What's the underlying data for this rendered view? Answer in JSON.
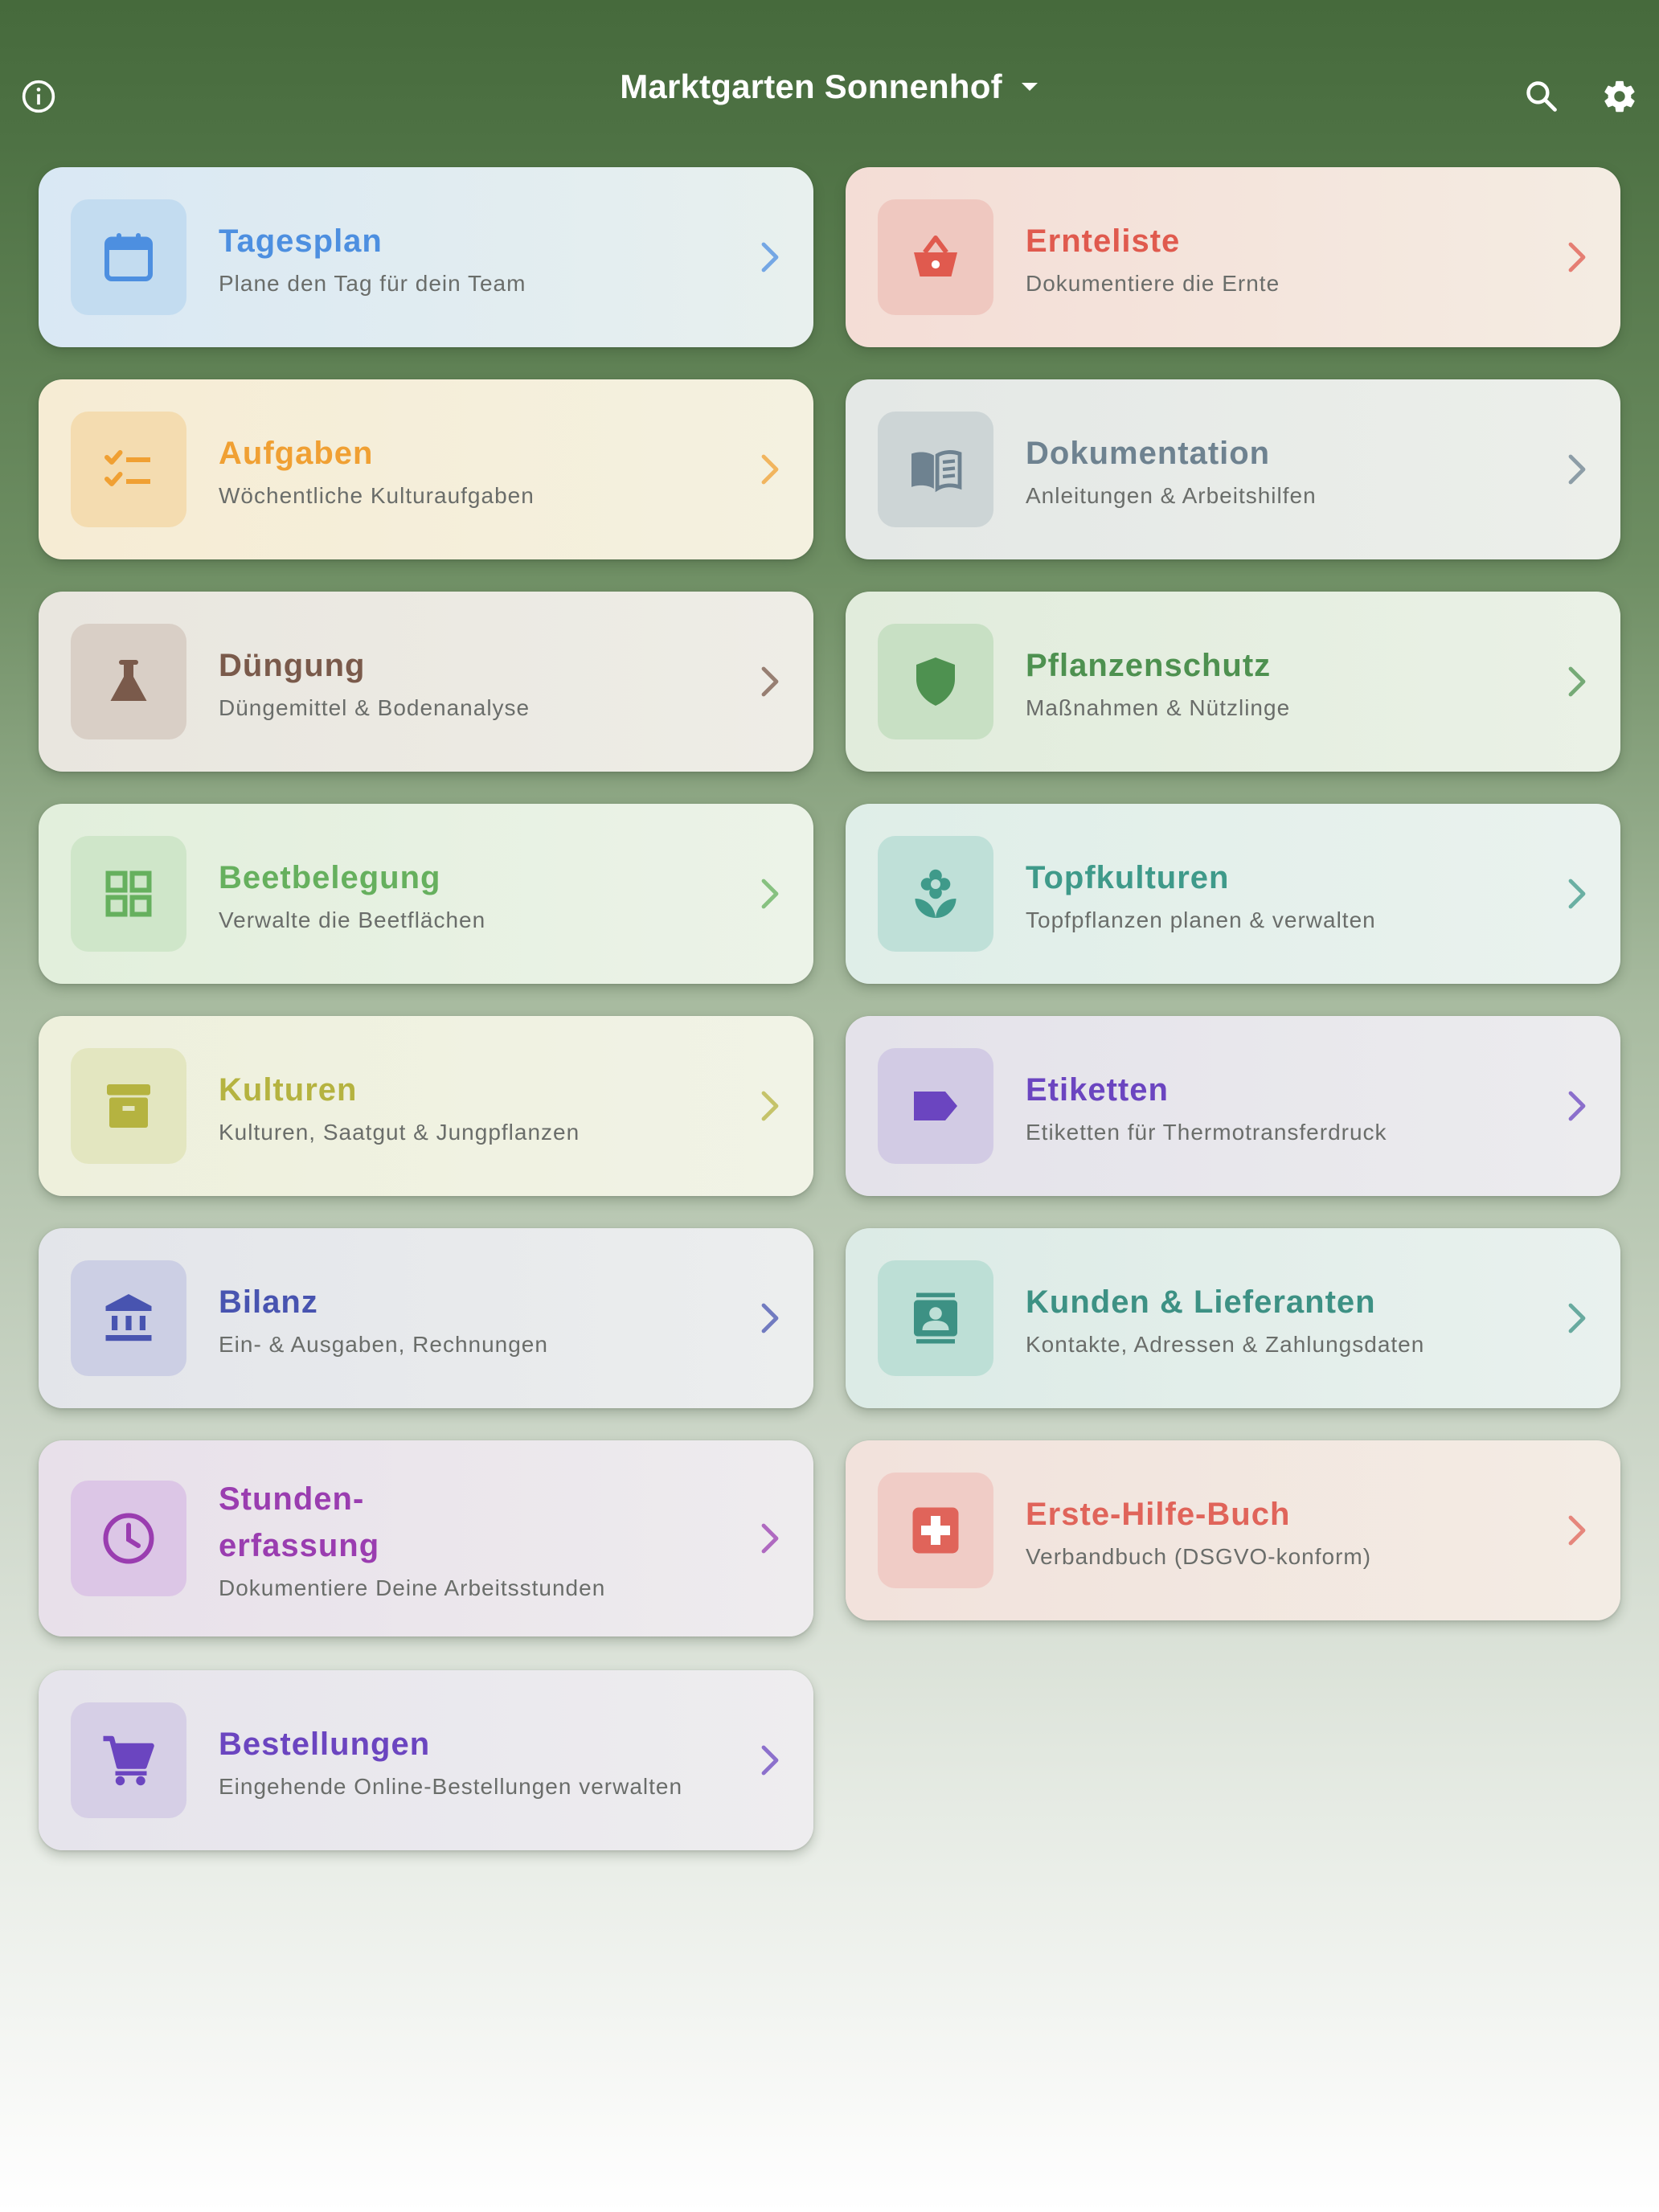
{
  "header": {
    "title": "Marktgarten Sonnenhof",
    "info_icon": "info-icon",
    "search_icon": "search-icon",
    "settings_icon": "gear-icon",
    "dropdown_icon": "caret-down-icon"
  },
  "cards": [
    {
      "id": "tagesplan",
      "title": "Tagesplan",
      "subtitle": "Plane den Tag für dein Team",
      "icon": "calendar-icon",
      "color": "#4d8fe0",
      "bg_from": "#d9e8f4",
      "bg_to": "#e8f0ee",
      "tile": "#c3dcf0"
    },
    {
      "id": "ernteliste",
      "title": "Ernteliste",
      "subtitle": "Dokumentiere die Ernte",
      "icon": "basket-icon",
      "color": "#e05a4e",
      "bg_from": "#f4ddd6",
      "bg_to": "#f4ece2",
      "tile": "#efc8c0"
    },
    {
      "id": "aufgaben",
      "title": "Aufgaben",
      "subtitle": "Wöchentliche Kulturaufgaben",
      "icon": "checklist-icon",
      "color": "#f0a033",
      "bg_from": "#f6ecd4",
      "bg_to": "#f4f1e0",
      "tile": "#f4dcb0"
    },
    {
      "id": "dokumentation",
      "title": "Dokumentation",
      "subtitle": "Anleitungen & Arbeitshilfen",
      "icon": "book-icon",
      "color": "#6e8290",
      "bg_from": "#e4e8e6",
      "bg_to": "#ecefea",
      "tile": "#cdd5d6"
    },
    {
      "id": "duengung",
      "title": "Düngung",
      "subtitle": "Düngemittel & Bodenanalyse",
      "icon": "flask-icon",
      "color": "#7a5a4b",
      "bg_from": "#e9e6df",
      "bg_to": "#eeede6",
      "tile": "#d9cfc6"
    },
    {
      "id": "pflanzenschutz",
      "title": "Pflanzenschutz",
      "subtitle": "Maßnahmen & Nützlinge",
      "icon": "shield-icon",
      "color": "#4e9150",
      "bg_from": "#e1ecdc",
      "bg_to": "#eaf1e6",
      "tile": "#c8e0c4"
    },
    {
      "id": "beetbelegung",
      "title": "Beetbelegung",
      "subtitle": "Verwalte die Beetflächen",
      "icon": "grid-icon",
      "color": "#66b05e",
      "bg_from": "#e2efdc",
      "bg_to": "#ecf3e8",
      "tile": "#cfe6c9"
    },
    {
      "id": "topfkulturen",
      "title": "Topfkulturen",
      "subtitle": "Topfpflanzen planen & verwalten",
      "icon": "flower-icon",
      "color": "#3f9a8a",
      "bg_from": "#dfeee8",
      "bg_to": "#eaf2ee",
      "tile": "#bfe0d8"
    },
    {
      "id": "kulturen",
      "title": "Kulturen",
      "subtitle": "Kulturen, Saatgut & Jungpflanzen",
      "icon": "archive-icon",
      "color": "#b5b340",
      "bg_from": "#eef0dc",
      "bg_to": "#f1f3e6",
      "tile": "#e3e6c0"
    },
    {
      "id": "etiketten",
      "title": "Etiketten",
      "subtitle": "Etiketten für Thermotransferdruck",
      "icon": "label-icon",
      "color": "#6b45c0",
      "bg_from": "#e4e2ea",
      "bg_to": "#ececee",
      "tile": "#d2cbe4"
    },
    {
      "id": "bilanz",
      "title": "Bilanz",
      "subtitle": "Ein- & Ausgaben, Rechnungen",
      "icon": "bank-icon",
      "color": "#4854b0",
      "bg_from": "#e3e5ea",
      "bg_to": "#eceeee",
      "tile": "#cccfe4"
    },
    {
      "id": "kunden",
      "title": "Kunden & Lieferanten",
      "subtitle": "Kontakte, Adressen & Zahlungsdaten",
      "icon": "contacts-icon",
      "color": "#3d9184",
      "bg_from": "#dcebe6",
      "bg_to": "#e9f1ee",
      "tile": "#bddfd6"
    },
    {
      "id": "stunden",
      "title": "Stunden-\nerfassung",
      "subtitle": "Dokumentiere Deine Arbeitsstunden",
      "icon": "clock-icon",
      "color": "#9a3db0",
      "bg_from": "#e8e0ea",
      "bg_to": "#eeecee",
      "tile": "#dcc6e6"
    },
    {
      "id": "erste-hilfe",
      "title": "Erste-Hilfe-Buch",
      "subtitle": "Verbandbuch (DSGVO-konform)",
      "icon": "first-aid-icon",
      "color": "#e0645a",
      "bg_from": "#f2e2dc",
      "bg_to": "#f3ece4",
      "tile": "#f0ccc6"
    },
    {
      "id": "bestellungen",
      "title": "Bestellungen",
      "subtitle": "Eingehende Online-Bestellungen verwalten",
      "icon": "cart-icon",
      "color": "#6b45c0",
      "bg_from": "#e6e4ec",
      "bg_to": "#eeedef",
      "tile": "#d6cfe6"
    }
  ]
}
